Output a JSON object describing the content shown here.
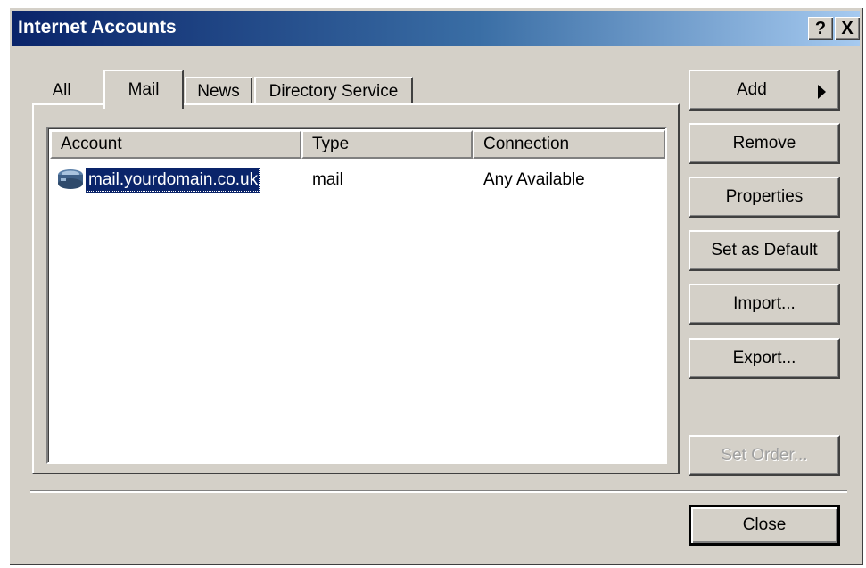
{
  "window": {
    "title": "Internet Accounts",
    "help_label": "?",
    "close_label": "X"
  },
  "tabs": [
    {
      "label": "All"
    },
    {
      "label": "Mail",
      "selected": true
    },
    {
      "label": "News"
    },
    {
      "label": "Directory Service"
    }
  ],
  "list": {
    "columns": [
      "Account",
      "Type",
      "Connection"
    ],
    "rows": [
      {
        "account": "mail.yourdomain.co.uk",
        "type": "mail",
        "connection": "Any Available",
        "icon": "mail-server-icon",
        "selected": true
      }
    ]
  },
  "buttons": {
    "add": "Add",
    "remove": "Remove",
    "properties": "Properties",
    "set_default": "Set as Default",
    "import": "Import...",
    "export": "Export...",
    "set_order": "Set Order...",
    "close": "Close"
  },
  "colors": {
    "titlebar_start": "#0a246a",
    "titlebar_end": "#a6caf0",
    "face": "#d4d0c8",
    "selection": "#0a246a"
  }
}
